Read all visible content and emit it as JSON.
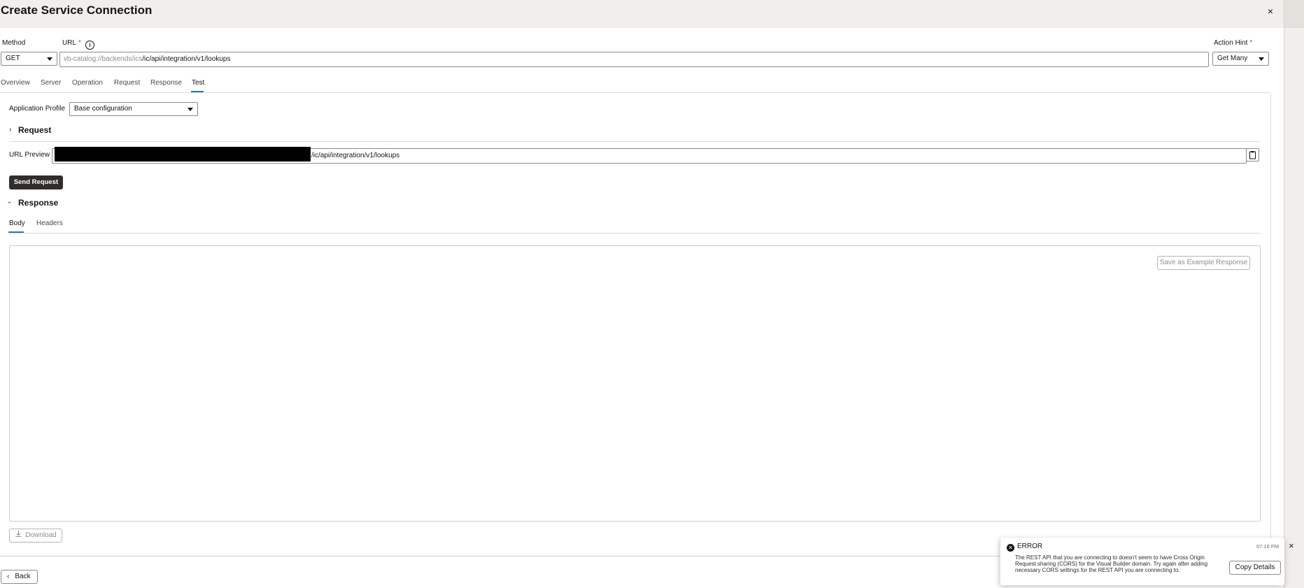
{
  "dialog": {
    "title": "Create Service Connection",
    "close_icon": "×"
  },
  "method": {
    "label": "Method",
    "value": "GET"
  },
  "url": {
    "label": "URL",
    "required_mark": "*",
    "info_icon": "i",
    "prefix": "vb-catalog://backends/ics",
    "path": "/ic/api/integration/v1/lookups"
  },
  "action_hint": {
    "label": "Action Hint",
    "required_mark": "*",
    "value": "Get Many"
  },
  "tabs": [
    {
      "label": "Overview"
    },
    {
      "label": "Server"
    },
    {
      "label": "Operation"
    },
    {
      "label": "Request"
    },
    {
      "label": "Response"
    },
    {
      "label": "Test"
    }
  ],
  "active_tab": "Test",
  "app_profile": {
    "label": "Application Profile",
    "value": "Base configuration"
  },
  "request_section": {
    "title": "Request",
    "chevron": "›"
  },
  "url_preview": {
    "label": "URL Preview",
    "path": "/ic/api/integration/v1/lookups"
  },
  "send_request": {
    "label": "Send Request"
  },
  "response_section": {
    "title": "Response",
    "chevron": "›"
  },
  "response_tabs": [
    {
      "label": "Body"
    },
    {
      "label": "Headers"
    }
  ],
  "save_example": {
    "label": "Save as Example Response"
  },
  "download": {
    "label": "Download",
    "icon": "download-icon"
  },
  "back": {
    "label": "Back",
    "icon": "‹"
  },
  "toast": {
    "title": "ERROR",
    "time": "07:16 PM",
    "message": "The REST API that you are connecting to doesn't seem to have Cross Origin Request sharing (CORS) for the Visual Builder domain. Try again after adding necessary CORS settings for the REST API you are connecting to.",
    "copy_label": "Copy Details",
    "close_icon": "×"
  },
  "colors": {
    "accent": "#227e9e",
    "dark_button": "#312d2a",
    "topbar": "#f1efed"
  }
}
